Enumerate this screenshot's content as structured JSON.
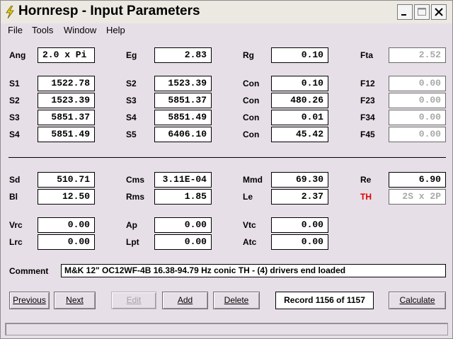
{
  "window": {
    "title": "Hornresp - Input Parameters"
  },
  "menu": [
    "File",
    "Tools",
    "Window",
    "Help"
  ],
  "labels": {
    "ang": "Ang",
    "eg": "Eg",
    "rg": "Rg",
    "fta": "Fta",
    "s1": "S1",
    "s2": "S2",
    "s3": "S3",
    "s4": "S4",
    "s2b": "S2",
    "s3b": "S3",
    "s4b": "S4",
    "s5": "S5",
    "con": "Con",
    "f12": "F12",
    "f23": "F23",
    "f34": "F34",
    "f45": "F45",
    "sd": "Sd",
    "cms": "Cms",
    "mmd": "Mmd",
    "re": "Re",
    "bl": "Bl",
    "rms": "Rms",
    "le": "Le",
    "th": "TH",
    "vrc": "Vrc",
    "ap": "Ap",
    "vtc": "Vtc",
    "lrc": "Lrc",
    "lpt": "Lpt",
    "atc": "Atc",
    "comment": "Comment"
  },
  "values": {
    "ang": "2.0 x Pi",
    "eg": "2.83",
    "rg": "0.10",
    "fta": "2.52",
    "s1": "1522.78",
    "s2": "1523.39",
    "s3": "5851.37",
    "s4": "5851.49",
    "s2b": "1523.39",
    "s3b": "5851.37",
    "s4b": "5851.49",
    "s5": "6406.10",
    "con1": "0.10",
    "con2": "480.26",
    "con3": "0.01",
    "con4": "45.42",
    "f12": "0.00",
    "f23": "0.00",
    "f34": "0.00",
    "f45": "0.00",
    "sd": "510.71",
    "cms": "3.11E-04",
    "mmd": "69.30",
    "re": "6.90",
    "bl": "12.50",
    "rms": "1.85",
    "le": "2.37",
    "th": "2S x 2P",
    "vrc": "0.00",
    "ap": "0.00",
    "vtc": "0.00",
    "lrc": "0.00",
    "lpt": "0.00",
    "atc": "0.00"
  },
  "comment": "M&K 12\" OC12WF-4B 16.38-94.79 Hz conic TH - (4) drivers end loaded",
  "buttons": {
    "previous": "Previous",
    "next": "Next",
    "edit": "Edit",
    "add": "Add",
    "delete": "Delete",
    "calculate": "Calculate"
  },
  "record": "Record 1156 of 1157",
  "colors": {
    "background": "#e7dfe7",
    "th_label": "#e00000",
    "disabled_text": "#a8a8a8"
  }
}
